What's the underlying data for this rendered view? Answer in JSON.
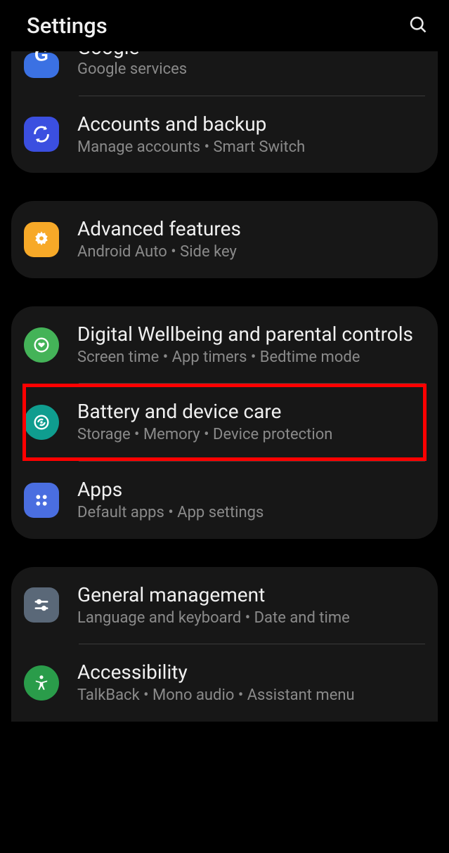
{
  "header": {
    "title": "Settings"
  },
  "items": {
    "google": {
      "title": "Google",
      "subtitle": "Google services"
    },
    "accounts": {
      "title": "Accounts and backup",
      "subtitle": "Manage accounts  •  Smart Switch"
    },
    "advanced": {
      "title": "Advanced features",
      "subtitle": "Android Auto  •  Side key"
    },
    "wellbeing": {
      "title": "Digital Wellbeing and parental controls",
      "subtitle": "Screen time  •  App timers  •  Bedtime mode"
    },
    "battery": {
      "title": "Battery and device care",
      "subtitle": "Storage  •  Memory  •  Device protection"
    },
    "apps": {
      "title": "Apps",
      "subtitle": "Default apps  •  App settings"
    },
    "general": {
      "title": "General management",
      "subtitle": "Language and keyboard  •  Date and time"
    },
    "accessibility": {
      "title": "Accessibility",
      "subtitle": "TalkBack  •  Mono audio  •  Assistant menu"
    }
  }
}
